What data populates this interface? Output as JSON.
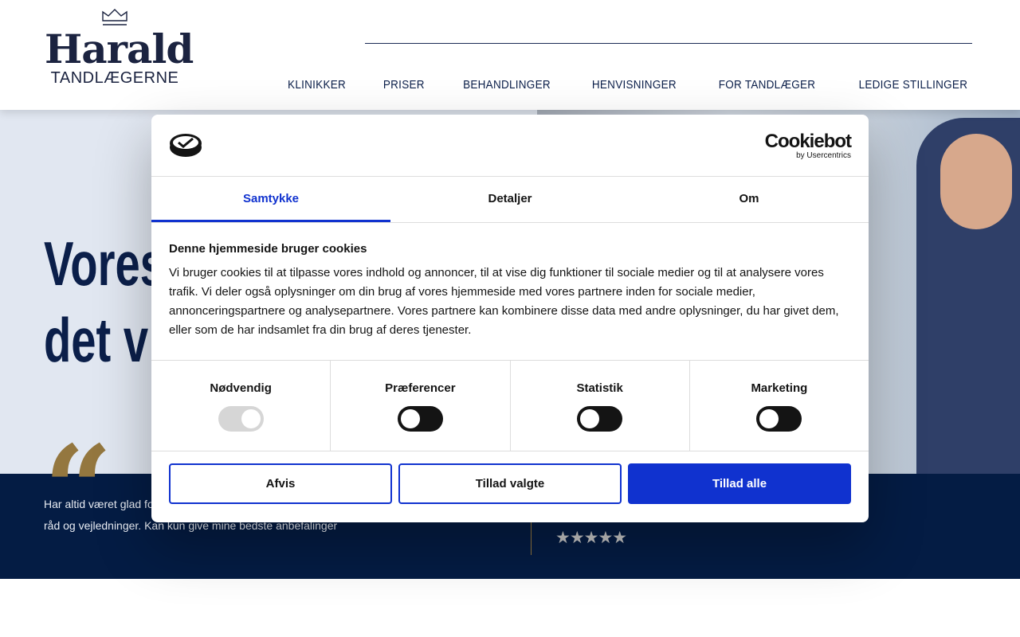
{
  "header": {
    "logo_main": "Harald",
    "logo_sub": "TANDLÆGERNE",
    "nav": [
      "KLINIKKER",
      "PRISER",
      "BEHANDLINGER",
      "HENVISNINGER",
      "FOR TANDLÆGER",
      "LEDIGE STILLINGER"
    ]
  },
  "hero": {
    "title_line1": "Vores",
    "title_line2": "det vi"
  },
  "review": {
    "quote_mark": "“",
    "text": "Har altid været glad for at komme her. Venligt personale, kompetente behandlinger og gode råd og vejledninger. Kan kun give mine bedste anbefalinger",
    "stars": "★★★★★",
    "rating": 5
  },
  "cookie": {
    "brand": "Cookiebot",
    "brand_sub": "by Usercentrics",
    "tabs": [
      "Samtykke",
      "Detaljer",
      "Om"
    ],
    "heading": "Denne hjemmeside bruger cookies",
    "body": "Vi bruger cookies til at tilpasse vores indhold og annoncer, til at vise dig funktioner til sociale medier og til at analysere vores trafik. Vi deler også oplysninger om din brug af vores hjemmeside med vores partnere inden for sociale medier, annonceringspartnere og analysepartnere. Vores partnere kan kombinere disse data med andre oplysninger, du har givet dem, eller som de har indsamlet fra din brug af deres tjenester.",
    "categories": [
      {
        "label": "Nødvendig",
        "enabled": true
      },
      {
        "label": "Præferencer",
        "enabled": false
      },
      {
        "label": "Statistik",
        "enabled": false
      },
      {
        "label": "Marketing",
        "enabled": false
      }
    ],
    "buttons": {
      "reject": "Afvis",
      "allow_selected": "Tillad valgte",
      "allow_all": "Tillad alle"
    }
  }
}
